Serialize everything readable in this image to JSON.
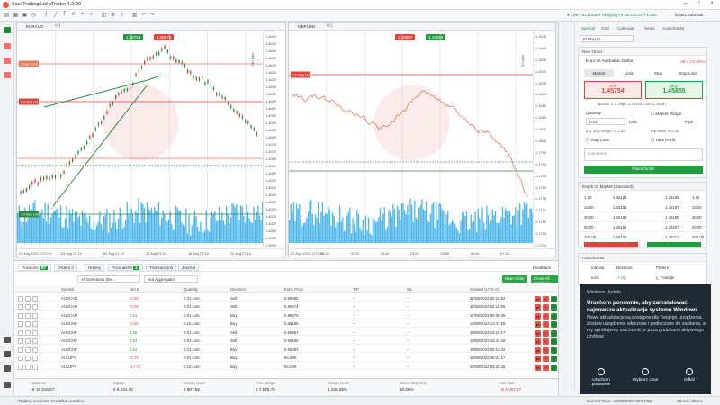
{
  "app": {
    "title": "Xaxi Trading Ltd cTrader 4.2.20",
    "live_status": "● Live • 2121935 • Hedging • € 18 216.57 • 1:500",
    "user": "lukasz.sobczak",
    "colors": {
      "buy": "#1f9d3f",
      "sell": "#e0443e",
      "accent": "#2b8a3e",
      "volume": "#2aa8e8"
    }
  },
  "toolbar": {
    "icons": [
      "new-chart-icon",
      "layout-icon",
      "templates-icon",
      "period-icon",
      "indicators-icon",
      "draw-line-icon",
      "text-icon",
      "fibonacci-icon",
      "crosshair-icon",
      "zoom-icon",
      "screenshot-icon",
      "settings-icon",
      "share-icon"
    ]
  },
  "chart1": {
    "symbol": "EURAUD",
    "period": "m1",
    "sell_price": "1.45754",
    "buy_price": "1.45878",
    "axis_right": [
      "1.4650",
      "1.4645",
      "1.4640",
      "1.4635",
      "1.4630",
      "1.4625",
      "1.4620",
      "1.4615",
      "1.4610",
      "1.4605",
      "1.4600",
      "1.4595",
      "1.4590",
      "1.4585",
      "1.4580",
      "1.4575",
      "1.4570",
      "1.4565",
      "1.4560",
      "1.4555",
      "1.4550",
      "1.4545",
      "1.4540",
      "1.4535",
      "1.4530",
      "1.4525",
      "1.4520",
      "1.4515",
      "1.4510",
      "1.4505"
    ],
    "axis_bottom": [
      "22 Aug 2022, UTC+0",
      "03 Aug 07:10",
      "05 Aug 07:10",
      "17 Aug 07:10",
      "18 Aug 07:10",
      "22 Aug 07:10"
    ],
    "labels": [
      "2 Buy Limit",
      "2.0 Sell Limit",
      "1.0 Buy Limit",
      "0.5 Buy Limit"
    ],
    "pips_label": "180 pips"
  },
  "chart2": {
    "symbol": "GBPUSD",
    "period": "m1",
    "sell_price": "1.18097",
    "buy_price": "1.18098",
    "axis_right": [
      "1.1845",
      "1.1840",
      "1.1835",
      "1.1830",
      "1.1825",
      "1.1820",
      "1.1815",
      "1.1810",
      "1.1805",
      "1.1800",
      "1.1795",
      "1.1790",
      "1.1785",
      "1.1780",
      "1.1775",
      "1.1770",
      "1.1765",
      "1.1760",
      "1.1755"
    ],
    "axis_bottom": [
      "22 Aug 2022, UTC+0",
      "01:40",
      "02:20",
      "03:44",
      "04:52",
      "05:56",
      "06:40",
      "07:35"
    ],
    "labels": [
      "1.0 Buy Limit",
      "0.5 Buy Limit"
    ],
    "pips_label": "92 pips"
  },
  "sidebar": {
    "tabs": [
      "Symbol",
      "Grid",
      "Calendar",
      "News",
      "Autochartist"
    ],
    "symbol": "EURAUD",
    "new_order": {
      "header": "New Order",
      "pair_name": "Euro vs Australian Dollar",
      "change": "-28.1 (-0.69%)",
      "order_types": [
        "Market",
        "Limit",
        "Stop",
        "Stop Limit"
      ],
      "sell_label": "Sell",
      "sell_price": "1.45754",
      "buy_label": "Buy",
      "buy_price": "1.45855",
      "spread_info": "Spread: 0.2, High: 1.46183, Low: 1.45397",
      "quantity_label": "Quantity",
      "quantity_value": "0.01",
      "quantity_unit": "Lots",
      "market_range_label": "Market Range",
      "pips_label": "Pips",
      "est_margin": "Est. Buy margin: € 2.50",
      "pip_value": "Pip value: € 0.06",
      "stop_loss_label": "Stop Loss",
      "take_profit_label": "Take Profit",
      "comment_label": "Comment",
      "place_order_label": "Place Order"
    },
    "depth": {
      "header": "Depth Of Market (Standard)",
      "rows": [
        [
          "1.00",
          "1.45184",
          "1.46186",
          "1.00"
        ],
        [
          "15.00",
          "1.45183",
          "1.46187",
          "15.00"
        ],
        [
          "30.00",
          "1.45182",
          "1.46188",
          "30.00"
        ],
        [
          "50.00",
          "1.45181",
          "1.46207",
          "50.00"
        ],
        [
          "100.00",
          "1.45180",
          "1.46213",
          "100.00"
        ]
      ]
    },
    "autochartist": {
      "header": "Autochartist",
      "cols": [
        "Interval",
        "Direction",
        "Pattern"
      ],
      "row": [
        "m15",
        "Up",
        "Triangle"
      ]
    },
    "econ": "Consumer Confidence Index"
  },
  "toast": {
    "app_name": "Windows Update",
    "title": "Uruchom ponownie, aby zainstalować najnowsze aktualizacje systemu Windows",
    "body": "Nowe aktualizacje są dostępne dla Twojego urządzenia. Zostaw urządzenie włączone i podłączone do zasilania, a my spróbujemy uruchomić je poza godzinami aktywnego użytkow",
    "actions": [
      "Uruchom ponownie",
      "Wybierz czas",
      "Odłóż"
    ]
  },
  "bottom": {
    "tabs": [
      "Positions",
      "Orders",
      "History",
      "Price alerts",
      "Transactions",
      "Journal"
    ],
    "positions_count": "87",
    "orders_count": "0",
    "alerts_count": "1",
    "feedback": "Feedback",
    "filter_direction": "All Directions (De...",
    "filter_agg": "Not Aggregated",
    "new_order_btn": "New Order",
    "close_all_btn": "Close All Positions",
    "columns": [
      "Symbol",
      "Net €",
      "Quantity",
      "Direction",
      "Entry Price",
      "T/P",
      "S/L",
      "Created (UTC+0)"
    ],
    "rows": [
      [
        "AUDCAD",
        "-0.09",
        "0.01 Lots",
        "Sell",
        "0.89680",
        "–",
        "–",
        "22/08/2022 05:10:52"
      ],
      [
        "AUDCAD",
        "-0.05",
        "0.01 Lots",
        "Sell",
        "0.89674",
        "–",
        "–",
        "22/08/2022 05:16:05"
      ],
      [
        "AUDCAD",
        "0.51",
        "0.01 Lots",
        "Buy",
        "0.89575",
        "–",
        "–",
        "17/08/2022 06:38:46"
      ],
      [
        "AUDCHF",
        "-0.00",
        "0.10 Lots",
        "Buy",
        "0.66186",
        "–",
        "–",
        "18/08/2022 13:41:26"
      ],
      [
        "AUDCHF",
        "1.56",
        "0.01 Lots",
        "Sell",
        "0.66567",
        "–",
        "–",
        "19/08/2022 19:16:17"
      ],
      [
        "AUDCHF",
        "0.04",
        "0.01 Lots",
        "Sell",
        "0.66190",
        "–",
        "–",
        "18/08/2022 16:44:49"
      ],
      [
        "AUDCHF",
        "2.51",
        "0.01 Lots",
        "Buy",
        "0.66093",
        "–",
        "–",
        "18/08/2022 05:10:32"
      ],
      [
        "AUDJPY",
        "-1.79",
        "0.01 Lots",
        "Buy",
        "94.686",
        "–",
        "–",
        "19/08/2022 06:04:17"
      ],
      [
        "AUDJPY",
        "-17.72",
        "0.10 Lots",
        "Buy",
        "94.009",
        "–",
        "–",
        "22/08/2022 05:25:35"
      ]
    ],
    "summary": {
      "labels": [
        "Balance",
        "Equity",
        "Margin Used",
        "Free Margin",
        "Margin Level",
        "Smart Stop Out",
        "Unr. Net"
      ],
      "values": [
        "€ 18 216.57",
        "€ 9 241.39",
        "€ 607.55",
        "€ 7 575.75",
        "1 238.45%",
        "50.00%",
        "-€ 1 957.37"
      ]
    }
  },
  "status": {
    "session": "Trading sessions: Frankfurt, London",
    "current_time": "Current Time:",
    "time": "22/08/2022 09:07:52",
    "ping": "18 ms / 20 ms"
  }
}
